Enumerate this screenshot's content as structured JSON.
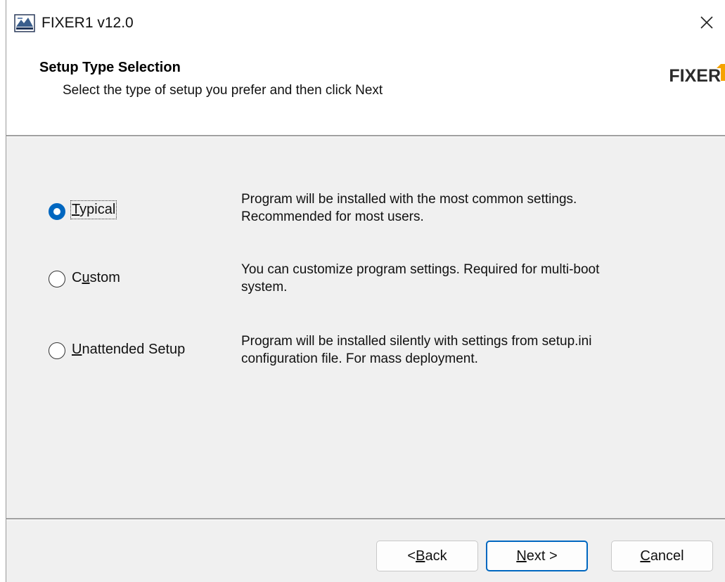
{
  "window": {
    "title": "FIXER1 v12.0"
  },
  "header": {
    "title": "Setup Type Selection",
    "subtitle": "Select the type of setup you prefer and then click Next",
    "brand": "FIXER",
    "brand_accent_color": "#f5a300"
  },
  "options": [
    {
      "label": "Typical",
      "selected": true,
      "description_line1": "Program will be installed with the most common settings.",
      "description_line2": "Recommended for most users."
    },
    {
      "label": "Custom",
      "selected": false,
      "description_line1": "You can customize program settings. Required for multi-boot",
      "description_line2": "system."
    },
    {
      "label": "Unattended Setup",
      "selected": false,
      "description_line1": "Program will be installed silently with settings from setup.ini",
      "description_line2": "configuration file. For mass deployment."
    }
  ],
  "buttons": {
    "back": "< Back",
    "next": "Next >",
    "cancel": "Cancel"
  },
  "colors": {
    "accent": "#0067c0",
    "panel_bg": "#f0f0f0"
  },
  "icons": {
    "app": "installer-icon",
    "close": "close-icon"
  }
}
